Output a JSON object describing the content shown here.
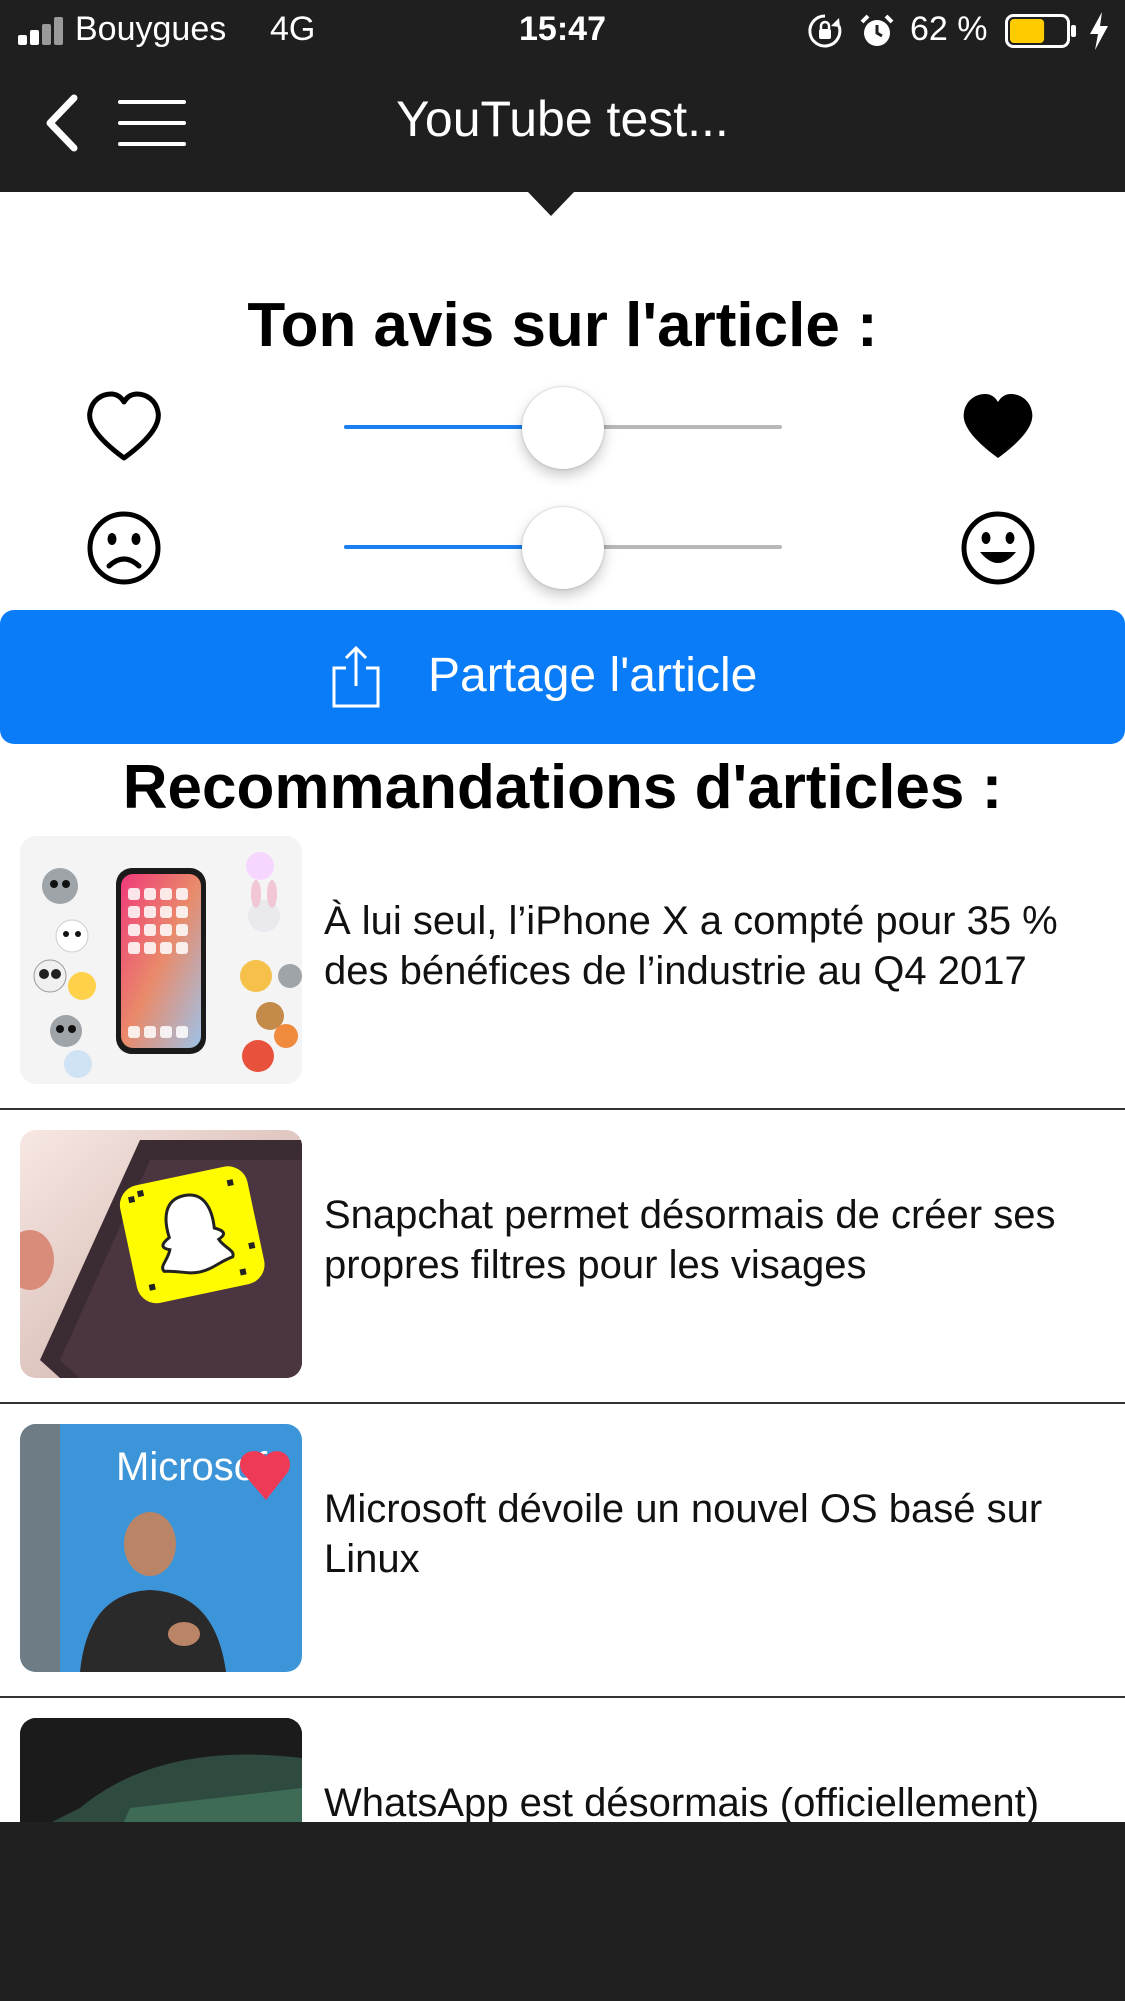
{
  "status_bar": {
    "carrier": "Bouygues",
    "network": "4G",
    "time": "15:47",
    "battery_percent": "62 %",
    "battery_level": 0.62,
    "battery_color": "#ffcc00"
  },
  "nav": {
    "title": "YouTube test..."
  },
  "rating": {
    "title": "Ton avis sur l'article :",
    "like_slider": {
      "value": 0.5,
      "left_icon": "heart-outline-icon",
      "right_icon": "heart-filled-icon"
    },
    "mood_slider": {
      "value": 0.5,
      "left_icon": "sad-face-icon",
      "right_icon": "happy-face-icon"
    },
    "accent_color": "#1a7ff0"
  },
  "share": {
    "label": "Partage l'article",
    "icon": "share-icon",
    "color": "#0a7cf7"
  },
  "recommendations": {
    "title": "Recommandations d'articles :",
    "items": [
      {
        "headline": "À lui seul, l’iPhone X a compté pour 35 % des bénéfices de l’industrie au Q4 2017",
        "thumbnail": "iphone-x-animoji-thumbnail"
      },
      {
        "headline": "Snapchat permet désormais de créer ses propres filtres pour les visages",
        "thumbnail": "snapchat-phone-thumbnail"
      },
      {
        "headline": "Microsoft dévoile un nouvel OS basé sur Linux",
        "thumbnail": "microsoft-keynote-thumbnail"
      },
      {
        "headline": "WhatsApp est désormais (officiellement)",
        "thumbnail": "whatsapp-phone-thumbnail"
      }
    ]
  }
}
